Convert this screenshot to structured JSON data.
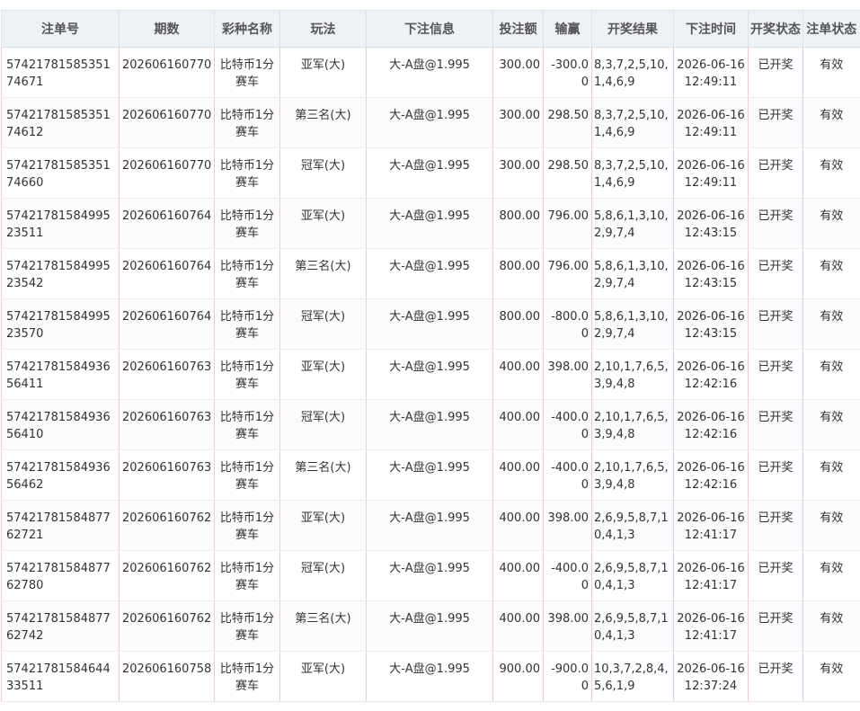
{
  "headers": [
    "注单号",
    "期数",
    "彩种名称",
    "玩法",
    "下注信息",
    "投注额",
    "输赢",
    "开奖结果",
    "下注时间",
    "开奖状态",
    "注单状态"
  ],
  "rows": [
    {
      "order": "5742178158535174671",
      "issue": "202606160770",
      "lottery": "比特币1分赛车",
      "play": "亚军(大)",
      "bet": "大-A盘@1.995",
      "amount": "300.00",
      "win": "-300.00",
      "result": "8,3,7,2,5,10,1,4,6,9",
      "time": "2026-06-16 12:49:11",
      "open": "已开奖",
      "valid": "有效"
    },
    {
      "order": "5742178158535174612",
      "issue": "202606160770",
      "lottery": "比特币1分赛车",
      "play": "第三名(大)",
      "bet": "大-A盘@1.995",
      "amount": "300.00",
      "win": "298.50",
      "result": "8,3,7,2,5,10,1,4,6,9",
      "time": "2026-06-16 12:49:11",
      "open": "已开奖",
      "valid": "有效"
    },
    {
      "order": "5742178158535174660",
      "issue": "202606160770",
      "lottery": "比特币1分赛车",
      "play": "冠军(大)",
      "bet": "大-A盘@1.995",
      "amount": "300.00",
      "win": "298.50",
      "result": "8,3,7,2,5,10,1,4,6,9",
      "time": "2026-06-16 12:49:11",
      "open": "已开奖",
      "valid": "有效"
    },
    {
      "order": "5742178158499523511",
      "issue": "202606160764",
      "lottery": "比特币1分赛车",
      "play": "亚军(大)",
      "bet": "大-A盘@1.995",
      "amount": "800.00",
      "win": "796.00",
      "result": "5,8,6,1,3,10,2,9,7,4",
      "time": "2026-06-16 12:43:15",
      "open": "已开奖",
      "valid": "有效"
    },
    {
      "order": "5742178158499523542",
      "issue": "202606160764",
      "lottery": "比特币1分赛车",
      "play": "第三名(大)",
      "bet": "大-A盘@1.995",
      "amount": "800.00",
      "win": "796.00",
      "result": "5,8,6,1,3,10,2,9,7,4",
      "time": "2026-06-16 12:43:15",
      "open": "已开奖",
      "valid": "有效"
    },
    {
      "order": "5742178158499523570",
      "issue": "202606160764",
      "lottery": "比特币1分赛车",
      "play": "冠军(大)",
      "bet": "大-A盘@1.995",
      "amount": "800.00",
      "win": "-800.00",
      "result": "5,8,6,1,3,10,2,9,7,4",
      "time": "2026-06-16 12:43:15",
      "open": "已开奖",
      "valid": "有效"
    },
    {
      "order": "5742178158493656411",
      "issue": "202606160763",
      "lottery": "比特币1分赛车",
      "play": "亚军(大)",
      "bet": "大-A盘@1.995",
      "amount": "400.00",
      "win": "398.00",
      "result": "2,10,1,7,6,5,3,9,4,8",
      "time": "2026-06-16 12:42:16",
      "open": "已开奖",
      "valid": "有效"
    },
    {
      "order": "5742178158493656410",
      "issue": "202606160763",
      "lottery": "比特币1分赛车",
      "play": "冠军(大)",
      "bet": "大-A盘@1.995",
      "amount": "400.00",
      "win": "-400.00",
      "result": "2,10,1,7,6,5,3,9,4,8",
      "time": "2026-06-16 12:42:16",
      "open": "已开奖",
      "valid": "有效"
    },
    {
      "order": "5742178158493656462",
      "issue": "202606160763",
      "lottery": "比特币1分赛车",
      "play": "第三名(大)",
      "bet": "大-A盘@1.995",
      "amount": "400.00",
      "win": "-400.00",
      "result": "2,10,1,7,6,5,3,9,4,8",
      "time": "2026-06-16 12:42:16",
      "open": "已开奖",
      "valid": "有效"
    },
    {
      "order": "5742178158487762721",
      "issue": "202606160762",
      "lottery": "比特币1分赛车",
      "play": "亚军(大)",
      "bet": "大-A盘@1.995",
      "amount": "400.00",
      "win": "398.00",
      "result": "2,6,9,5,8,7,10,4,1,3",
      "time": "2026-06-16 12:41:17",
      "open": "已开奖",
      "valid": "有效"
    },
    {
      "order": "5742178158487762780",
      "issue": "202606160762",
      "lottery": "比特币1分赛车",
      "play": "冠军(大)",
      "bet": "大-A盘@1.995",
      "amount": "400.00",
      "win": "-400.00",
      "result": "2,6,9,5,8,7,10,4,1,3",
      "time": "2026-06-16 12:41:17",
      "open": "已开奖",
      "valid": "有效"
    },
    {
      "order": "5742178158487762742",
      "issue": "202606160762",
      "lottery": "比特币1分赛车",
      "play": "第三名(大)",
      "bet": "大-A盘@1.995",
      "amount": "400.00",
      "win": "398.00",
      "result": "2,6,9,5,8,7,10,4,1,3",
      "time": "2026-06-16 12:41:17",
      "open": "已开奖",
      "valid": "有效"
    },
    {
      "order": "5742178158464433511",
      "issue": "202606160758",
      "lottery": "比特币1分赛车",
      "play": "亚军(大)",
      "bet": "大-A盘@1.995",
      "amount": "900.00",
      "win": "-900.00",
      "result": "10,3,7,2,8,4,5,6,1,9",
      "time": "2026-06-16 12:37:24",
      "open": "已开奖",
      "valid": "有效"
    }
  ]
}
